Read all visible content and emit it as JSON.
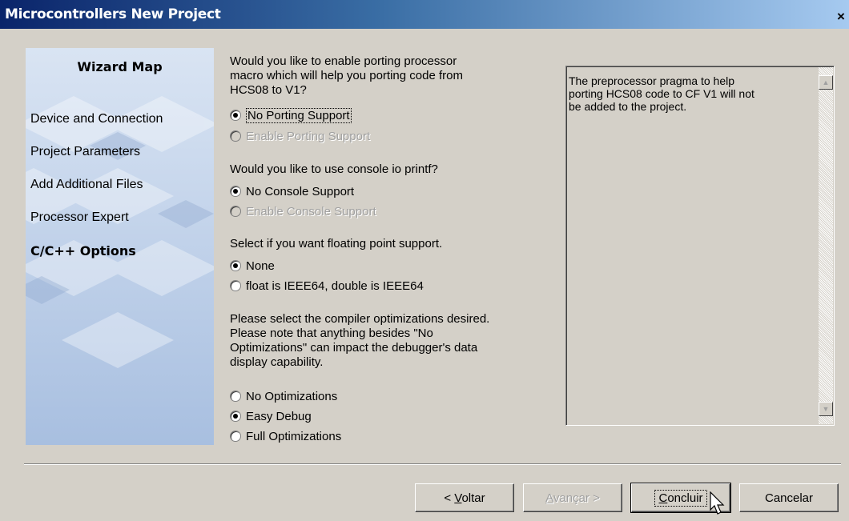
{
  "window": {
    "title": "Microcontrollers New Project",
    "close_glyph": "×"
  },
  "wizard_map": {
    "title": "Wizard Map",
    "steps": [
      {
        "label": "Device and Connection",
        "active": false
      },
      {
        "label": "Project Parameters",
        "active": false
      },
      {
        "label": "Add Additional Files",
        "active": false
      },
      {
        "label": "Processor Expert",
        "active": false
      },
      {
        "label": "C/C++ Options",
        "active": true
      }
    ]
  },
  "porting": {
    "question": [
      "Would you like to enable porting processor",
      "macro which will help you porting code from",
      "HCS08 to V1?"
    ],
    "options": [
      {
        "label": "No Porting Support",
        "checked": true,
        "enabled": true
      },
      {
        "label": "Enable Porting Support",
        "checked": false,
        "enabled": false
      }
    ]
  },
  "console": {
    "question": "Would you like to use console io printf?",
    "options": [
      {
        "label": "No Console Support",
        "checked": true,
        "enabled": true
      },
      {
        "label": "Enable Console Support",
        "checked": false,
        "enabled": false
      }
    ]
  },
  "floating": {
    "question": "Select if you want floating point support.",
    "options": [
      {
        "label": "None",
        "checked": true,
        "enabled": true
      },
      {
        "label": "float is IEEE64, double is IEEE64",
        "checked": false,
        "enabled": true
      }
    ]
  },
  "optimizations": {
    "question": [
      "Please select the compiler optimizations desired.",
      "Please note that anything besides \"No",
      "Optimizations\" can impact the debugger's data",
      "display capability."
    ],
    "options": [
      {
        "label": "No Optimizations",
        "checked": false,
        "enabled": true
      },
      {
        "label": "Easy Debug",
        "checked": true,
        "enabled": true
      },
      {
        "label": "Full Optimizations",
        "checked": false,
        "enabled": true
      }
    ]
  },
  "description": {
    "lines": [
      "The preprocessor pragma to help",
      "porting HCS08 code to CF V1 will not",
      "be added to the project."
    ],
    "scroll_up_glyph": "▲",
    "scroll_down_glyph": "▼"
  },
  "buttons": {
    "back_prefix": "< ",
    "back_mnemonic": "V",
    "back_rest": "oltar",
    "next_mnemonic": "A",
    "next_rest": "vançar >",
    "finish_mnemonic": "C",
    "finish_rest": "oncluir",
    "cancel": "Cancelar"
  }
}
